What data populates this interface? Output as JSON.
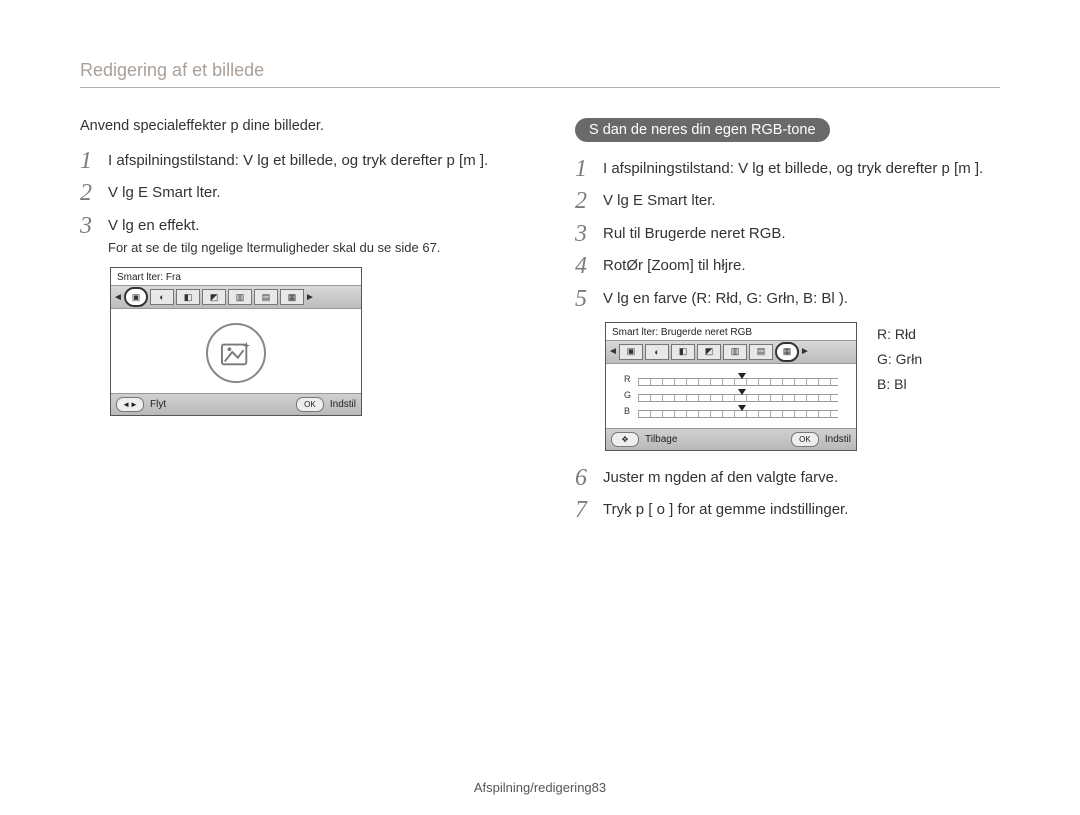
{
  "page": {
    "title": "Redigering af et billede",
    "footer": "Afspilning/redigering83"
  },
  "left": {
    "intro": "Anvend specialeffekter p  dine billeder.",
    "steps": [
      {
        "num": "1",
        "text": "I afspilningstilstand: V lg et billede, og tryk derefter p  [m      ]."
      },
      {
        "num": "2",
        "text": "V lg   E        Smart lter."
      },
      {
        "num": "3",
        "text": "V lg en effekt.",
        "note": "For at se de tilg ngelige  ltermuligheder skal du se side 67."
      }
    ],
    "lcd": {
      "header": "Smart lter: Fra",
      "footer_left_key": "◄►",
      "footer_left": "Flyt",
      "footer_right_key": "OK",
      "footer_right": "Indstil"
    }
  },
  "right": {
    "pill": "S dan de neres din egen RGB-tone",
    "steps": [
      {
        "num": "1",
        "text": "I afspilningstilstand: V lg et billede, og tryk derefter p  [m      ]."
      },
      {
        "num": "2",
        "text": "V lg   E        Smart lter."
      },
      {
        "num": "3",
        "text": "Rul til Brugerde neret RGB."
      },
      {
        "num": "4",
        "text": "RotØr [Zoom] til hłjre."
      },
      {
        "num": "5",
        "text": "V lg en farve (R: Rłd, G: Grłn, B: Bl )."
      }
    ],
    "lcd": {
      "header": "Smart lter: Brugerde neret RGB",
      "rows": [
        "R",
        "G",
        "B"
      ],
      "footer_left_key": "✥",
      "footer_left": "Tilbage",
      "footer_right_key": "OK",
      "footer_right": "Indstil"
    },
    "legend": {
      "r": "R: Rłd",
      "g": "G: Grłn",
      "b": "B: Bl"
    },
    "steps_after": [
      {
        "num": "6",
        "text": "Juster m ngden af den valgte farve."
      },
      {
        "num": "7",
        "text": "Tryk p  [ o    ] for at gemme indstillinger."
      }
    ]
  }
}
